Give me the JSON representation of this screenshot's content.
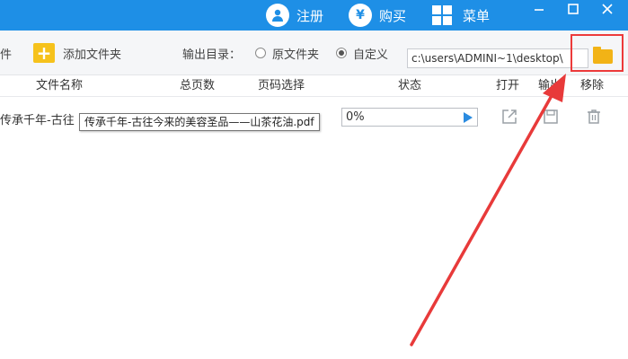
{
  "titlebar": {
    "register_label": "注册",
    "buy_label": "购买",
    "menu_label": "菜单",
    "buy_glyph": "¥",
    "minimize_glyph": "—",
    "maximize_glyph": "☐",
    "close_glyph": "✕"
  },
  "toolbar": {
    "partial_label": "件",
    "add_folder_label": "添加文件夹",
    "output_dir_label": "输出目录：",
    "option_original": "原文件夹",
    "option_custom": "自定义",
    "selected_option": "自定义",
    "path_value": "c:\\users\\ADMINI~1\\desktop\\"
  },
  "table": {
    "columns": [
      "文件名称",
      "总页数",
      "页码选择",
      "状态",
      "打开",
      "输出",
      "移除"
    ],
    "rows": [
      {
        "file_name": "传承千年-古往",
        "progress": "0%"
      }
    ]
  },
  "tooltip": {
    "text": "传承千年-古往今来的美容圣品——山茶花油.pdf"
  },
  "colors": {
    "titlebar": "#1e8fe6",
    "accent_yellow": "#f6c21c",
    "highlight_red": "#ec3a3a",
    "play_blue": "#2a8be0"
  },
  "icons": [
    "user-icon",
    "yen-icon",
    "grid-icon",
    "plus-icon",
    "folder-icon",
    "play-icon",
    "open-icon",
    "save-icon",
    "trash-icon"
  ]
}
